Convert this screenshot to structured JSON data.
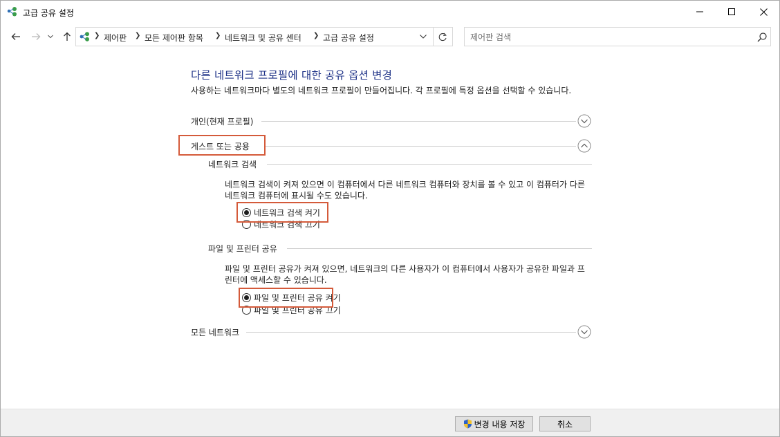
{
  "window": {
    "title": "고급 공유 설정"
  },
  "nav": {
    "back_icon": "back-arrow-icon",
    "forward_icon": "forward-arrow-icon",
    "recent_icon": "chevron-down-icon",
    "up_icon": "up-arrow-icon"
  },
  "address": {
    "crumbs": [
      "제어판",
      "모든 제어판 항목",
      "네트워크 및 공유 센터",
      "고급 공유 설정"
    ]
  },
  "search": {
    "placeholder": "제어판 검색",
    "value": ""
  },
  "main": {
    "title": "다른 네트워크 프로필에 대한 공유 옵션 변경",
    "description": "사용하는 네트워크마다 별도의 네트워크 프로필이 만들어집니다. 각 프로필에 특정 옵션을 선택할 수 있습니다.",
    "profiles": {
      "private": {
        "label": "개인(현재 프로필)",
        "expanded": false
      },
      "guest": {
        "label": "게스트 또는 공용",
        "expanded": true
      },
      "all": {
        "label": "모든 네트워크",
        "expanded": false
      }
    },
    "discovery": {
      "label": "네트워크 검색",
      "description": "네트워크 검색이 켜져 있으면 이 컴퓨터에서 다른 네트워크 컴퓨터와 장치를 볼 수 있고 이 컴퓨터가 다른 네트워크 컴퓨터에 표시될 수도 있습니다.",
      "on_label": "네트워크 검색 켜기",
      "off_label": "네트워크 검색 끄기",
      "selected": "on"
    },
    "file_sharing": {
      "label": "파일 및 프린터 공유",
      "description": "파일 및 프린터 공유가 켜져 있으면, 네트워크의 다른 사용자가 이 컴퓨터에서 사용자가 공유한 파일과 프린터에 액세스할 수 있습니다.",
      "on_label": "파일 및 프린터 공유 켜기",
      "off_label": "파일 및 프린터 공유 끄기",
      "selected": "on"
    }
  },
  "footer": {
    "save_label": "변경 내용 저장",
    "cancel_label": "취소"
  },
  "colors": {
    "title_blue": "#1e3287",
    "highlight": "#d45a3a",
    "footer_bg": "#f0f0f0"
  }
}
